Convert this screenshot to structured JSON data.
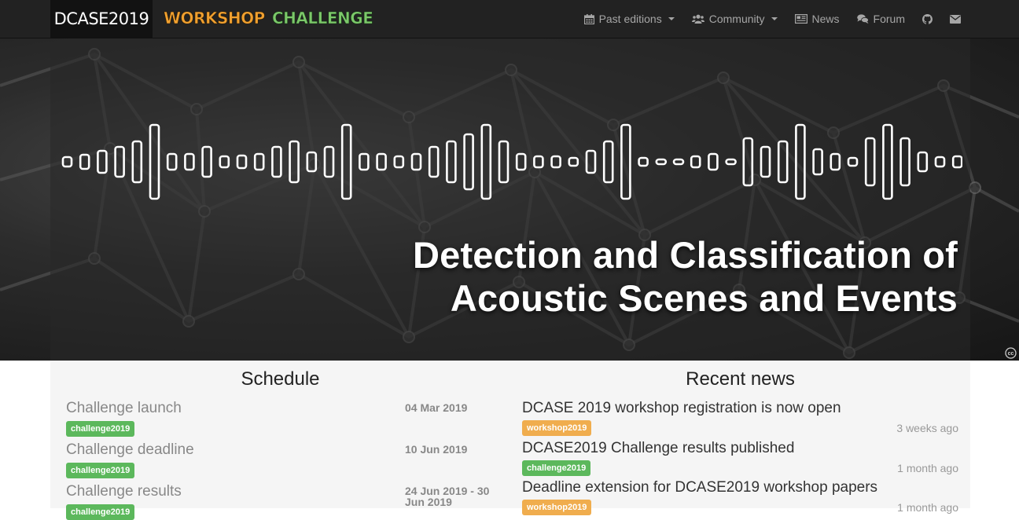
{
  "brand": {
    "title": "DCASE2019",
    "workshop": "WORKSHOP",
    "challenge": "CHALLENGE"
  },
  "nav": {
    "past_editions": "Past editions",
    "community": "Community",
    "news": "News",
    "forum": "Forum",
    "icons": [
      "calendar-icon",
      "users-icon",
      "newspaper-icon",
      "comments-icon",
      "github-icon",
      "envelope-icon"
    ]
  },
  "hero": {
    "title_line1": "Detection and Classification of",
    "title_line2": "Acoustic Scenes and Events"
  },
  "schedule": {
    "title": "Schedule",
    "items": [
      {
        "name": "Challenge launch",
        "date": "04 Mar 2019",
        "tag": "challenge2019"
      },
      {
        "name": "Challenge deadline",
        "date": "10 Jun 2019",
        "tag": "challenge2019"
      },
      {
        "name": "Challenge results",
        "date": "24 Jun 2019 - 30 Jun 2019",
        "tag": "challenge2019"
      }
    ]
  },
  "news": {
    "title": "Recent news",
    "items": [
      {
        "headline": "DCASE 2019 workshop registration is now open",
        "tag": "workshop2019",
        "time": "3 weeks ago"
      },
      {
        "headline": "DCASE2019 Challenge results published",
        "tag": "challenge2019",
        "time": "1 month ago"
      },
      {
        "headline": "Deadline extension for DCASE2019 workshop papers",
        "tag": "workshop2019",
        "time": "1 month ago"
      }
    ]
  },
  "colors": {
    "navbar": "#222222",
    "workshop": "#f0a030",
    "challenge": "#7cc86a",
    "badge_green": "#5cb85c",
    "badge_orange": "#f0ad4e"
  }
}
